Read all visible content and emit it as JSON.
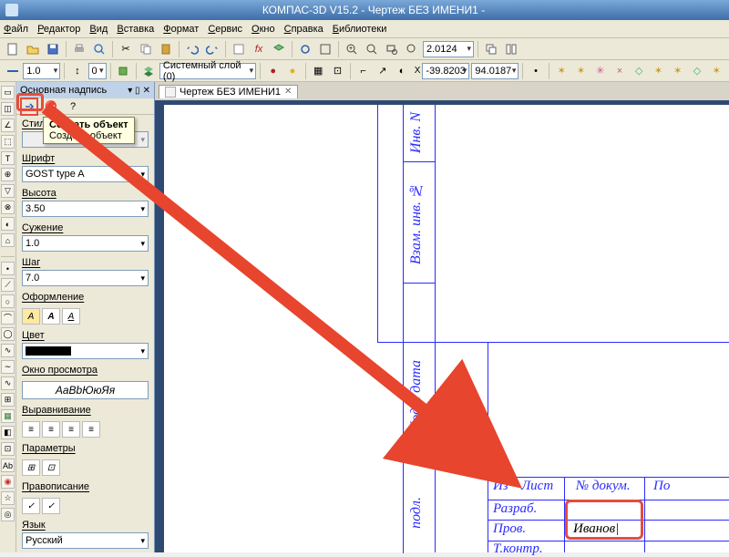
{
  "titlebar": {
    "title": "КОМПАС-3D V15.2  - Чертеж БЕЗ ИМЕНИ1 -"
  },
  "menu": [
    "Файл",
    "Редактор",
    "Вид",
    "Вставка",
    "Формат",
    "Сервис",
    "Окно",
    "Справка",
    "Библиотеки"
  ],
  "toolbar2": {
    "lineweight": "1.0",
    "input": "0",
    "layer": "Системный слой (0)"
  },
  "toolbar1": {
    "scale": "2.0124",
    "coord_x": "-39.8203",
    "coord_y": "94.0187"
  },
  "panel": {
    "header": "Основная надпись",
    "tooltip_title": "Создать объект",
    "tooltip_sub": "Создать объект",
    "style_lbl": "Стиль",
    "font_lbl": "Шрифт",
    "font_val": "GOST type A",
    "height_lbl": "Высота",
    "height_val": "3.50",
    "narrow_lbl": "Сужение",
    "narrow_val": "1.0",
    "step_lbl": "Шаг",
    "step_val": "7.0",
    "deco_lbl": "Оформление",
    "color_lbl": "Цвет",
    "preview_lbl": "Окно просмотра",
    "preview_val": "АаВbЮюЯя",
    "align_lbl": "Выравнивание",
    "params_lbl": "Параметры",
    "spell_lbl": "Правописание",
    "lang_lbl": "Язык",
    "lang_val": "Русский"
  },
  "doc": {
    "tab": "Чертеж БЕЗ ИМЕНИ1"
  },
  "drawing": {
    "inv_n": "Инв. N",
    "vzam": "Взам. инв. №",
    "podp_data": "Подп. дата",
    "podl": "подл.",
    "izm": "Из",
    "list": "Лист",
    "ndoc": "№ докум.",
    "po": "По",
    "razrab": "Разраб.",
    "prov": "Пров.",
    "tkontr": "Т.контр.",
    "ivanov": "Иванов|"
  },
  "icons": {
    "pin": "📌",
    "help": "?",
    "x": "✕"
  }
}
